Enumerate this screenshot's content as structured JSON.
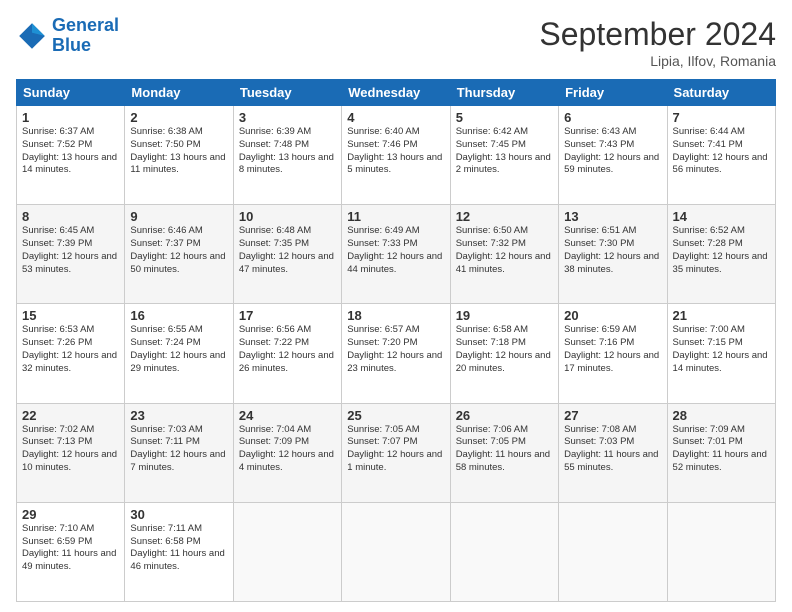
{
  "header": {
    "logo_line1": "General",
    "logo_line2": "Blue",
    "month_title": "September 2024",
    "subtitle": "Lipia, Ilfov, Romania"
  },
  "days_of_week": [
    "Sunday",
    "Monday",
    "Tuesday",
    "Wednesday",
    "Thursday",
    "Friday",
    "Saturday"
  ],
  "weeks": [
    [
      {
        "day": "1",
        "sunrise": "Sunrise: 6:37 AM",
        "sunset": "Sunset: 7:52 PM",
        "daylight": "Daylight: 13 hours and 14 minutes."
      },
      {
        "day": "2",
        "sunrise": "Sunrise: 6:38 AM",
        "sunset": "Sunset: 7:50 PM",
        "daylight": "Daylight: 13 hours and 11 minutes."
      },
      {
        "day": "3",
        "sunrise": "Sunrise: 6:39 AM",
        "sunset": "Sunset: 7:48 PM",
        "daylight": "Daylight: 13 hours and 8 minutes."
      },
      {
        "day": "4",
        "sunrise": "Sunrise: 6:40 AM",
        "sunset": "Sunset: 7:46 PM",
        "daylight": "Daylight: 13 hours and 5 minutes."
      },
      {
        "day": "5",
        "sunrise": "Sunrise: 6:42 AM",
        "sunset": "Sunset: 7:45 PM",
        "daylight": "Daylight: 13 hours and 2 minutes."
      },
      {
        "day": "6",
        "sunrise": "Sunrise: 6:43 AM",
        "sunset": "Sunset: 7:43 PM",
        "daylight": "Daylight: 12 hours and 59 minutes."
      },
      {
        "day": "7",
        "sunrise": "Sunrise: 6:44 AM",
        "sunset": "Sunset: 7:41 PM",
        "daylight": "Daylight: 12 hours and 56 minutes."
      }
    ],
    [
      {
        "day": "8",
        "sunrise": "Sunrise: 6:45 AM",
        "sunset": "Sunset: 7:39 PM",
        "daylight": "Daylight: 12 hours and 53 minutes."
      },
      {
        "day": "9",
        "sunrise": "Sunrise: 6:46 AM",
        "sunset": "Sunset: 7:37 PM",
        "daylight": "Daylight: 12 hours and 50 minutes."
      },
      {
        "day": "10",
        "sunrise": "Sunrise: 6:48 AM",
        "sunset": "Sunset: 7:35 PM",
        "daylight": "Daylight: 12 hours and 47 minutes."
      },
      {
        "day": "11",
        "sunrise": "Sunrise: 6:49 AM",
        "sunset": "Sunset: 7:33 PM",
        "daylight": "Daylight: 12 hours and 44 minutes."
      },
      {
        "day": "12",
        "sunrise": "Sunrise: 6:50 AM",
        "sunset": "Sunset: 7:32 PM",
        "daylight": "Daylight: 12 hours and 41 minutes."
      },
      {
        "day": "13",
        "sunrise": "Sunrise: 6:51 AM",
        "sunset": "Sunset: 7:30 PM",
        "daylight": "Daylight: 12 hours and 38 minutes."
      },
      {
        "day": "14",
        "sunrise": "Sunrise: 6:52 AM",
        "sunset": "Sunset: 7:28 PM",
        "daylight": "Daylight: 12 hours and 35 minutes."
      }
    ],
    [
      {
        "day": "15",
        "sunrise": "Sunrise: 6:53 AM",
        "sunset": "Sunset: 7:26 PM",
        "daylight": "Daylight: 12 hours and 32 minutes."
      },
      {
        "day": "16",
        "sunrise": "Sunrise: 6:55 AM",
        "sunset": "Sunset: 7:24 PM",
        "daylight": "Daylight: 12 hours and 29 minutes."
      },
      {
        "day": "17",
        "sunrise": "Sunrise: 6:56 AM",
        "sunset": "Sunset: 7:22 PM",
        "daylight": "Daylight: 12 hours and 26 minutes."
      },
      {
        "day": "18",
        "sunrise": "Sunrise: 6:57 AM",
        "sunset": "Sunset: 7:20 PM",
        "daylight": "Daylight: 12 hours and 23 minutes."
      },
      {
        "day": "19",
        "sunrise": "Sunrise: 6:58 AM",
        "sunset": "Sunset: 7:18 PM",
        "daylight": "Daylight: 12 hours and 20 minutes."
      },
      {
        "day": "20",
        "sunrise": "Sunrise: 6:59 AM",
        "sunset": "Sunset: 7:16 PM",
        "daylight": "Daylight: 12 hours and 17 minutes."
      },
      {
        "day": "21",
        "sunrise": "Sunrise: 7:00 AM",
        "sunset": "Sunset: 7:15 PM",
        "daylight": "Daylight: 12 hours and 14 minutes."
      }
    ],
    [
      {
        "day": "22",
        "sunrise": "Sunrise: 7:02 AM",
        "sunset": "Sunset: 7:13 PM",
        "daylight": "Daylight: 12 hours and 10 minutes."
      },
      {
        "day": "23",
        "sunrise": "Sunrise: 7:03 AM",
        "sunset": "Sunset: 7:11 PM",
        "daylight": "Daylight: 12 hours and 7 minutes."
      },
      {
        "day": "24",
        "sunrise": "Sunrise: 7:04 AM",
        "sunset": "Sunset: 7:09 PM",
        "daylight": "Daylight: 12 hours and 4 minutes."
      },
      {
        "day": "25",
        "sunrise": "Sunrise: 7:05 AM",
        "sunset": "Sunset: 7:07 PM",
        "daylight": "Daylight: 12 hours and 1 minute."
      },
      {
        "day": "26",
        "sunrise": "Sunrise: 7:06 AM",
        "sunset": "Sunset: 7:05 PM",
        "daylight": "Daylight: 11 hours and 58 minutes."
      },
      {
        "day": "27",
        "sunrise": "Sunrise: 7:08 AM",
        "sunset": "Sunset: 7:03 PM",
        "daylight": "Daylight: 11 hours and 55 minutes."
      },
      {
        "day": "28",
        "sunrise": "Sunrise: 7:09 AM",
        "sunset": "Sunset: 7:01 PM",
        "daylight": "Daylight: 11 hours and 52 minutes."
      }
    ],
    [
      {
        "day": "29",
        "sunrise": "Sunrise: 7:10 AM",
        "sunset": "Sunset: 6:59 PM",
        "daylight": "Daylight: 11 hours and 49 minutes."
      },
      {
        "day": "30",
        "sunrise": "Sunrise: 7:11 AM",
        "sunset": "Sunset: 6:58 PM",
        "daylight": "Daylight: 11 hours and 46 minutes."
      },
      null,
      null,
      null,
      null,
      null
    ]
  ]
}
